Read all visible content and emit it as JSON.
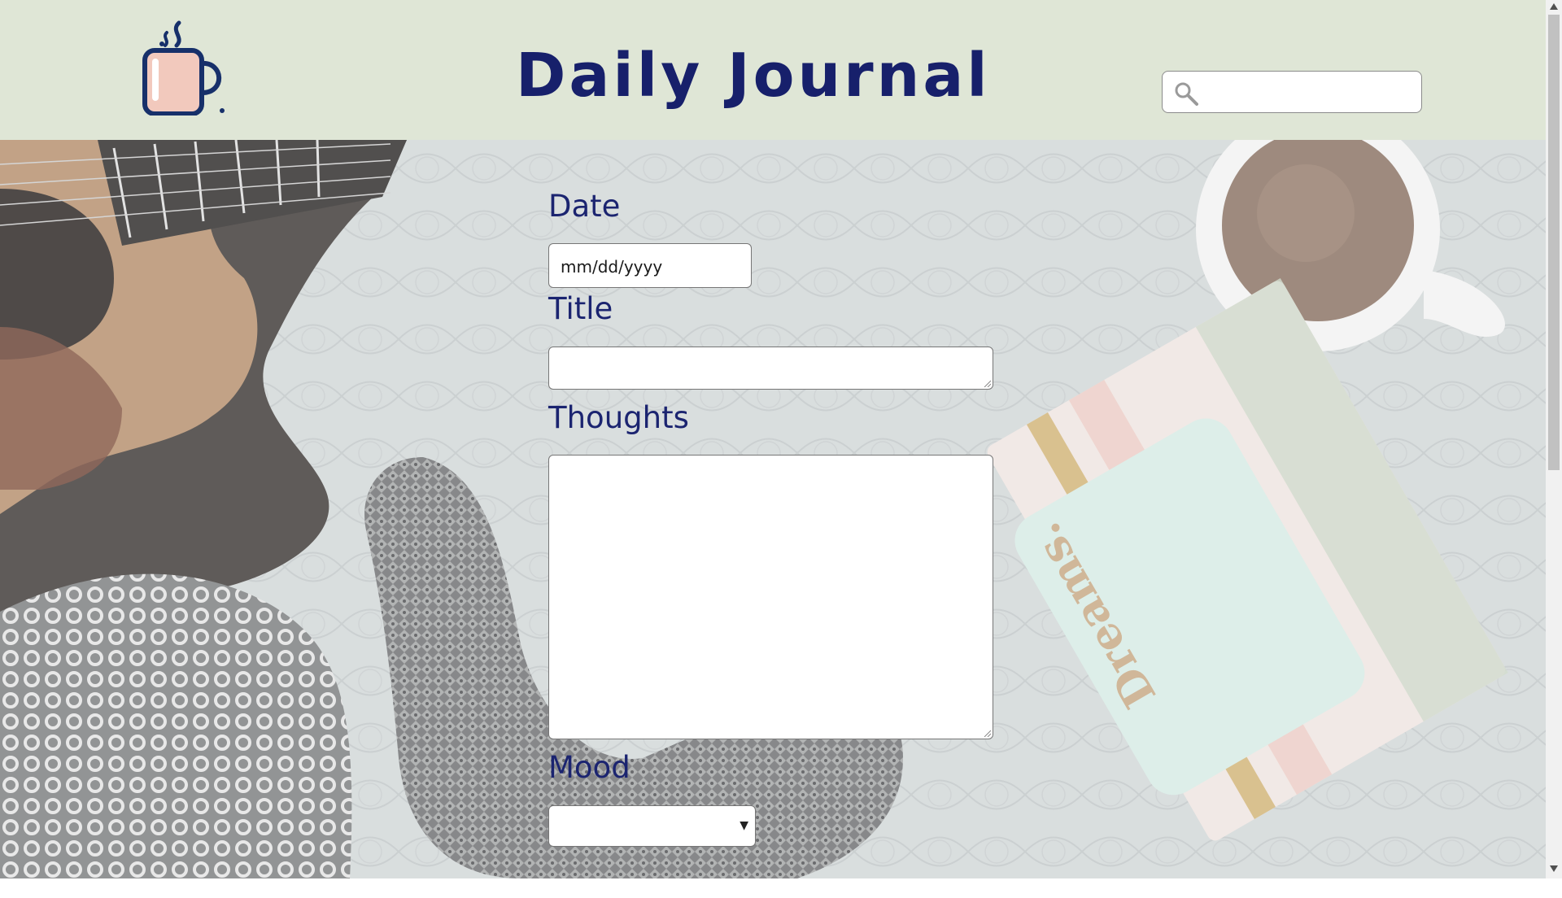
{
  "header": {
    "title": "Daily Journal",
    "logo_icon": "coffee-mug-icon",
    "search": {
      "icon": "search-icon",
      "value": "",
      "placeholder": ""
    }
  },
  "form": {
    "date": {
      "label": "Date",
      "placeholder": "mm/dd/yyyy"
    },
    "title": {
      "label": "Title",
      "value": ""
    },
    "thoughts": {
      "label": "Thoughts",
      "value": ""
    },
    "mood": {
      "label": "Mood",
      "selected": ""
    }
  },
  "background": {
    "notebook_text": "Dreams."
  },
  "colors": {
    "header_bg": "#dfe6d6",
    "title_color": "#17206b",
    "label_color": "#1b2470"
  }
}
